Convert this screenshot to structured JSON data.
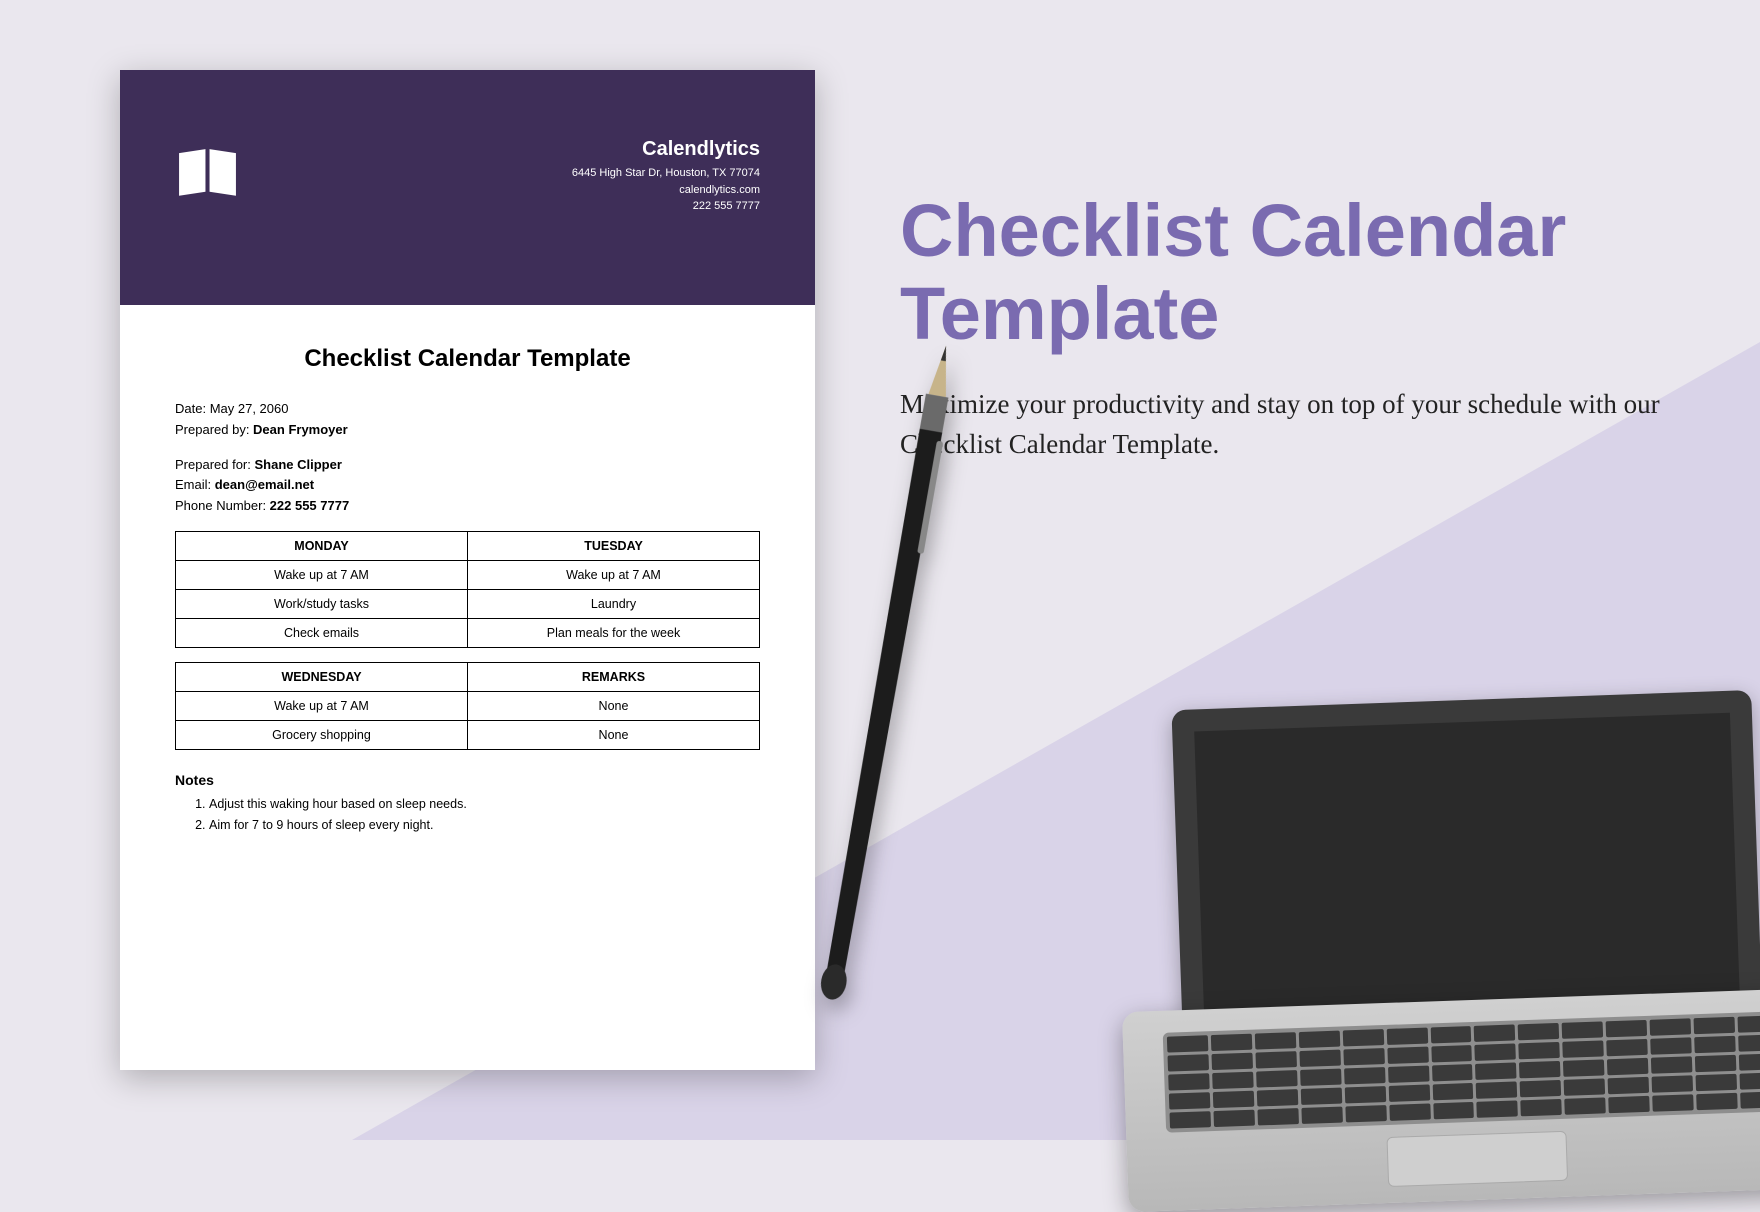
{
  "promo": {
    "title": "Checklist Calendar Template",
    "description": "Maximize your productivity and stay on top of your schedule with our Checklist Calendar Template."
  },
  "company": {
    "name": "Calendlytics",
    "address": "6445 High Star Dr, Houston, TX 77074",
    "website": "calendlytics.com",
    "phone": "222 555 7777"
  },
  "doc": {
    "title": "Checklist Calendar Template",
    "date_label": "Date: ",
    "date_value": "May 27, 2060",
    "prepared_by_label": "Prepared by: ",
    "prepared_by_value": "Dean Frymoyer",
    "prepared_for_label": "Prepared for: ",
    "prepared_for_value": "Shane Clipper",
    "email_label": "Email: ",
    "email_value": "dean@email.net",
    "phone_label": "Phone Number: ",
    "phone_value": "222 555 7777"
  },
  "table1": {
    "headers": [
      "MONDAY",
      "TUESDAY"
    ],
    "rows": [
      [
        "Wake up at 7 AM",
        "Wake up at 7 AM"
      ],
      [
        "Work/study tasks",
        "Laundry"
      ],
      [
        "Check emails",
        "Plan meals for the week"
      ]
    ]
  },
  "table2": {
    "headers": [
      "WEDNESDAY",
      "REMARKS"
    ],
    "rows": [
      [
        "Wake up at 7 AM",
        "None"
      ],
      [
        "Grocery shopping",
        "None"
      ]
    ]
  },
  "notes": {
    "title": "Notes",
    "items": [
      "Adjust this waking hour based on sleep needs.",
      "Aim for 7 to 9 hours of sleep every night."
    ]
  }
}
